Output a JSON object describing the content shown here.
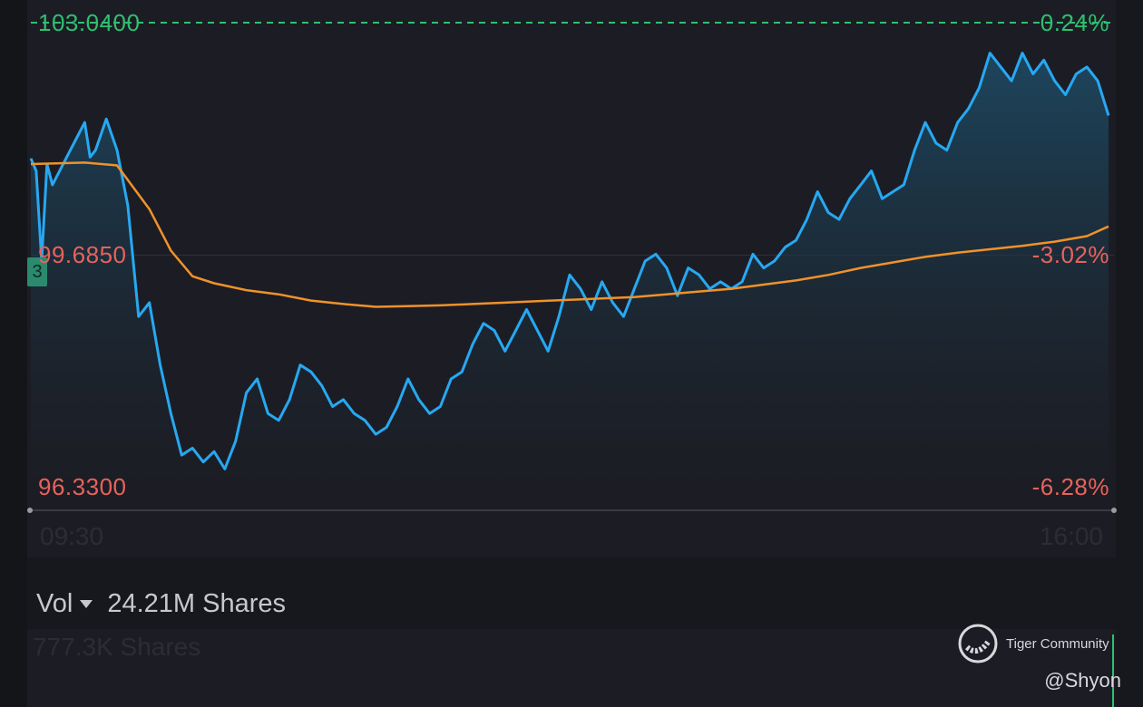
{
  "chart_data": {
    "type": "line",
    "x_start_label": "09:30",
    "x_end_label": "16:00",
    "ylim": [
      96.33,
      103.04
    ],
    "y_axis_left": [
      {
        "value": "103.0400",
        "color": "#2fbf71"
      },
      {
        "value": "99.6850",
        "color": "#e8625c"
      },
      {
        "value": "96.3300",
        "color": "#e8625c"
      }
    ],
    "y_axis_right": [
      {
        "value": "0.24%",
        "color": "#2fbf71"
      },
      {
        "value": "-3.02%",
        "color": "#e8625c"
      },
      {
        "value": "-6.28%",
        "color": "#e8625c"
      }
    ],
    "series": [
      {
        "color": "#27a8f2",
        "points": [
          [
            0,
            101.08
          ],
          [
            0.5,
            100.9
          ],
          [
            1,
            99.6
          ],
          [
            1.5,
            101.0
          ],
          [
            2,
            100.7
          ],
          [
            3,
            101.0
          ],
          [
            4,
            101.3
          ],
          [
            5,
            101.6
          ],
          [
            5.5,
            101.1
          ],
          [
            6,
            101.2
          ],
          [
            7,
            101.65
          ],
          [
            8,
            101.2
          ],
          [
            9,
            100.4
          ],
          [
            10,
            98.8
          ],
          [
            11,
            99.0
          ],
          [
            12,
            98.1
          ],
          [
            13,
            97.4
          ],
          [
            14,
            96.8
          ],
          [
            15,
            96.9
          ],
          [
            16,
            96.7
          ],
          [
            17,
            96.85
          ],
          [
            18,
            96.6
          ],
          [
            19,
            97.0
          ],
          [
            20,
            97.7
          ],
          [
            21,
            97.9
          ],
          [
            22,
            97.4
          ],
          [
            23,
            97.3
          ],
          [
            24,
            97.6
          ],
          [
            25,
            98.1
          ],
          [
            26,
            98.0
          ],
          [
            27,
            97.8
          ],
          [
            28,
            97.5
          ],
          [
            29,
            97.6
          ],
          [
            30,
            97.4
          ],
          [
            31,
            97.3
          ],
          [
            32,
            97.1
          ],
          [
            33,
            97.2
          ],
          [
            34,
            97.5
          ],
          [
            35,
            97.9
          ],
          [
            36,
            97.6
          ],
          [
            37,
            97.4
          ],
          [
            38,
            97.5
          ],
          [
            39,
            97.9
          ],
          [
            40,
            98.0
          ],
          [
            41,
            98.4
          ],
          [
            42,
            98.7
          ],
          [
            43,
            98.6
          ],
          [
            44,
            98.3
          ],
          [
            45,
            98.6
          ],
          [
            46,
            98.9
          ],
          [
            47,
            98.6
          ],
          [
            48,
            98.3
          ],
          [
            49,
            98.8
          ],
          [
            50,
            99.4
          ],
          [
            51,
            99.2
          ],
          [
            52,
            98.9
          ],
          [
            53,
            99.3
          ],
          [
            54,
            99.0
          ],
          [
            55,
            98.8
          ],
          [
            56,
            99.2
          ],
          [
            57,
            99.6
          ],
          [
            58,
            99.7
          ],
          [
            59,
            99.5
          ],
          [
            60,
            99.1
          ],
          [
            61,
            99.5
          ],
          [
            62,
            99.4
          ],
          [
            63,
            99.2
          ],
          [
            64,
            99.3
          ],
          [
            65,
            99.2
          ],
          [
            66,
            99.3
          ],
          [
            67,
            99.7
          ],
          [
            68,
            99.5
          ],
          [
            69,
            99.6
          ],
          [
            70,
            99.8
          ],
          [
            71,
            99.9
          ],
          [
            72,
            100.2
          ],
          [
            73,
            100.6
          ],
          [
            74,
            100.3
          ],
          [
            75,
            100.2
          ],
          [
            76,
            100.5
          ],
          [
            77,
            100.7
          ],
          [
            78,
            100.9
          ],
          [
            79,
            100.5
          ],
          [
            80,
            100.6
          ],
          [
            81,
            100.7
          ],
          [
            82,
            101.2
          ],
          [
            83,
            101.6
          ],
          [
            84,
            101.3
          ],
          [
            85,
            101.2
          ],
          [
            86,
            101.6
          ],
          [
            87,
            101.8
          ],
          [
            88,
            102.1
          ],
          [
            89,
            102.6
          ],
          [
            90,
            102.4
          ],
          [
            91,
            102.2
          ],
          [
            92,
            102.6
          ],
          [
            93,
            102.3
          ],
          [
            94,
            102.5
          ],
          [
            95,
            102.2
          ],
          [
            96,
            102.0
          ],
          [
            97,
            102.3
          ],
          [
            98,
            102.4
          ],
          [
            99,
            102.2
          ],
          [
            100,
            101.7
          ]
        ],
        "note": ""
      },
      {
        "color": "#f0922a",
        "points": [
          [
            0,
            101.0
          ],
          [
            5,
            101.02
          ],
          [
            8,
            100.98
          ],
          [
            11,
            100.35
          ],
          [
            13,
            99.75
          ],
          [
            15,
            99.38
          ],
          [
            17,
            99.28
          ],
          [
            20,
            99.18
          ],
          [
            23,
            99.12
          ],
          [
            26,
            99.03
          ],
          [
            29,
            98.98
          ],
          [
            32,
            98.94
          ],
          [
            35,
            98.95
          ],
          [
            38,
            98.96
          ],
          [
            41,
            98.98
          ],
          [
            44,
            99.0
          ],
          [
            47,
            99.02
          ],
          [
            50,
            99.04
          ],
          [
            53,
            99.06
          ],
          [
            56,
            99.08
          ],
          [
            59,
            99.12
          ],
          [
            62,
            99.16
          ],
          [
            65,
            99.2
          ],
          [
            68,
            99.26
          ],
          [
            71,
            99.32
          ],
          [
            74,
            99.4
          ],
          [
            77,
            99.5
          ],
          [
            80,
            99.58
          ],
          [
            83,
            99.66
          ],
          [
            86,
            99.72
          ],
          [
            89,
            99.77
          ],
          [
            92,
            99.82
          ],
          [
            95,
            99.88
          ],
          [
            98,
            99.96
          ],
          [
            100,
            100.1
          ]
        ]
      }
    ]
  },
  "volume": {
    "label": "Vol",
    "total": "24.21M Shares",
    "sub_value": "777.3K Shares"
  },
  "badge": "3",
  "watermark": {
    "brand": "Tiger Community",
    "handle": "@Shyon"
  }
}
